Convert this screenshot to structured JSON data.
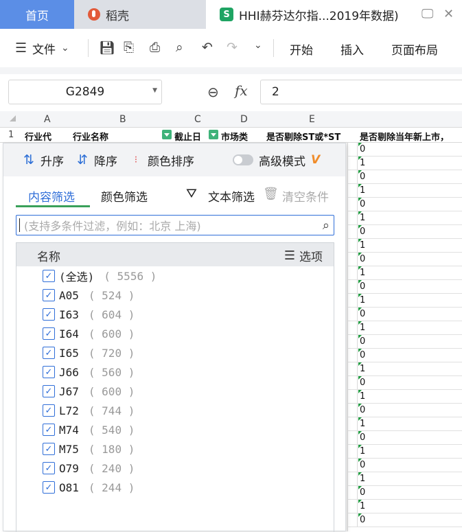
{
  "tabs": {
    "home": "首页",
    "daoke": "稻壳",
    "file": "HHI赫芬达尔指...2019年数据)",
    "file_icon": "S"
  },
  "toolbar": {
    "menu": "文件",
    "start": "开始",
    "insert": "插入",
    "layout": "页面布局"
  },
  "formula": {
    "cell_ref": "G2849",
    "fx": "fx",
    "value": "2"
  },
  "sheet": {
    "columns": [
      "A",
      "B",
      "C",
      "D",
      "E"
    ],
    "row_number": "1",
    "headers": [
      "行业代",
      "行业名称",
      "截止日",
      "市场类",
      "是否剔除ST或*ST",
      "是否剔除当年新上市，"
    ],
    "g_values": [
      "0",
      "1",
      "0",
      "1",
      "0",
      "1",
      "0",
      "1",
      "0",
      "1",
      "0",
      "1",
      "0",
      "1",
      "0",
      "0",
      "1",
      "0",
      "1",
      "0",
      "1",
      "0",
      "1",
      "0",
      "1",
      "0",
      "1",
      "0"
    ]
  },
  "filter_panel": {
    "sort_asc": "升序",
    "sort_desc": "降序",
    "color_sort": "颜色排序",
    "advanced": "高级模式",
    "vip": "V",
    "tab_content": "内容筛选",
    "tab_color": "颜色筛选",
    "text_filter": "文本筛选",
    "clear": "清空条件",
    "search_placeholder": "(支持多条件过滤，例如：北京 上海)",
    "list_header": "名称",
    "options": "选项",
    "items": [
      {
        "label": "(全选)",
        "count": "( 5556 )"
      },
      {
        "label": "A05",
        "count": "( 524 )"
      },
      {
        "label": "I63",
        "count": "( 604 )"
      },
      {
        "label": "I64",
        "count": "( 600 )"
      },
      {
        "label": "I65",
        "count": "( 720 )"
      },
      {
        "label": "J66",
        "count": "( 560 )"
      },
      {
        "label": "J67",
        "count": "( 600 )"
      },
      {
        "label": "L72",
        "count": "( 744 )"
      },
      {
        "label": "M74",
        "count": "( 540 )"
      },
      {
        "label": "M75",
        "count": "( 180 )"
      },
      {
        "label": "O79",
        "count": "( 240 )"
      },
      {
        "label": "O81",
        "count": "( 244 )"
      }
    ]
  }
}
